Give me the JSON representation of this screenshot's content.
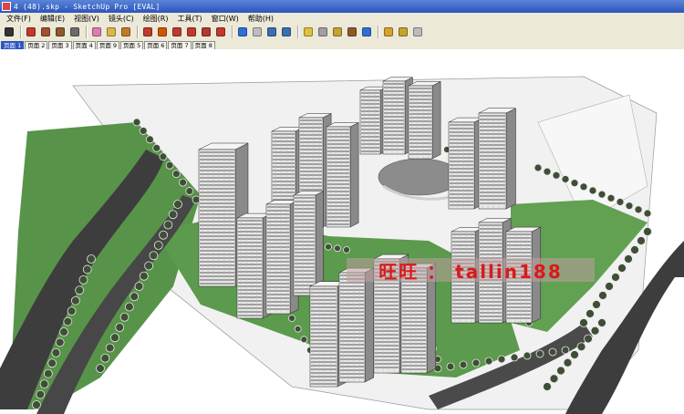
{
  "window": {
    "title": "4 (48).skp - SketchUp Pro [EVAL]"
  },
  "menu": [
    "文件(F)",
    "编辑(E)",
    "视图(V)",
    "镜头(C)",
    "绘图(R)",
    "工具(T)",
    "窗口(W)",
    "帮助(H)"
  ],
  "toolbar_tools": [
    {
      "name": "select-tool",
      "color": "#333333"
    },
    {
      "name": "sep"
    },
    {
      "name": "pencil-tool",
      "color": "#c0392b"
    },
    {
      "name": "rectangle-tool",
      "color": "#a0522d"
    },
    {
      "name": "circle-tool",
      "color": "#8b5a2b"
    },
    {
      "name": "arc-tool",
      "color": "#6b6b6b"
    },
    {
      "name": "sep"
    },
    {
      "name": "eraser-tool",
      "color": "#e07bb0"
    },
    {
      "name": "tape-measure-tool",
      "color": "#d9b84a"
    },
    {
      "name": "paint-bucket-tool",
      "color": "#c47a2c"
    },
    {
      "name": "sep"
    },
    {
      "name": "push-pull-tool",
      "color": "#c0392b"
    },
    {
      "name": "follow-me-tool",
      "color": "#d35400"
    },
    {
      "name": "move-tool",
      "color": "#c0392b"
    },
    {
      "name": "rotate-tool",
      "color": "#c0392b"
    },
    {
      "name": "offset-tool",
      "color": "#b03a2e"
    },
    {
      "name": "scale-tool",
      "color": "#c0392b"
    },
    {
      "name": "sep"
    },
    {
      "name": "orbit-tool",
      "color": "#2e6fd6"
    },
    {
      "name": "pan-tool",
      "color": "#bdbdbd"
    },
    {
      "name": "zoom-tool",
      "color": "#3a6fb0"
    },
    {
      "name": "zoom-extents-tool",
      "color": "#3a6fb0"
    },
    {
      "name": "sep"
    },
    {
      "name": "get-models-tool",
      "color": "#e0c040"
    },
    {
      "name": "share-model-tool",
      "color": "#a0a0a0"
    },
    {
      "name": "components-tool",
      "color": "#c8a030"
    },
    {
      "name": "walk-tool",
      "color": "#8b5a2b"
    },
    {
      "name": "google-earth-tool",
      "color": "#2e6fd6"
    },
    {
      "name": "sep"
    },
    {
      "name": "section-tool",
      "color": "#d9a030"
    },
    {
      "name": "photo-match-tool",
      "color": "#c8a030"
    },
    {
      "name": "styles-tool",
      "color": "#bbbbbb"
    }
  ],
  "scene_tabs": [
    "页面 1",
    "页面 2",
    "页面 3",
    "页面 4",
    "页面 9",
    "页面 5",
    "页面 6",
    "页面 7",
    "页面 8"
  ],
  "active_scene_tab": 0,
  "watermark": "旺旺 ： tallin188",
  "colors": {
    "titlebar": "#2a55bd",
    "ui_face": "#ece9d8",
    "grass": "#58934a",
    "road": "#3a3a3a",
    "ground": "#efefef",
    "watermark_text": "#d81a1a"
  }
}
